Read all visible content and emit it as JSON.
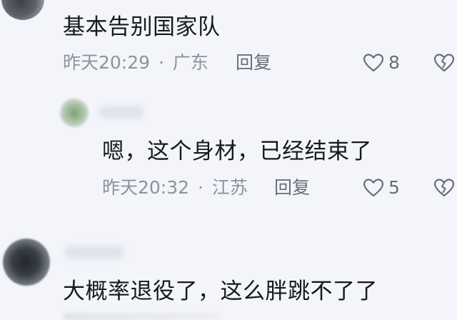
{
  "comments": [
    {
      "text": "基本告别国家队",
      "time": "昨天20:29",
      "location": "广东",
      "reply_label": "回复",
      "likes": "8"
    },
    {
      "text": "嗯，这个身材，已经结束了",
      "time": "昨天20:32",
      "location": "江苏",
      "reply_label": "回复",
      "likes": "5"
    },
    {
      "text": "大概率退役了，这么胖跳不了了"
    }
  ],
  "meta_separator": "·",
  "icons": {
    "like": "heart-outline-icon",
    "dislike": "broken-heart-icon"
  },
  "colors": {
    "background": "#f3f5fa",
    "text": "#16191d",
    "meta": "#8e939a"
  }
}
